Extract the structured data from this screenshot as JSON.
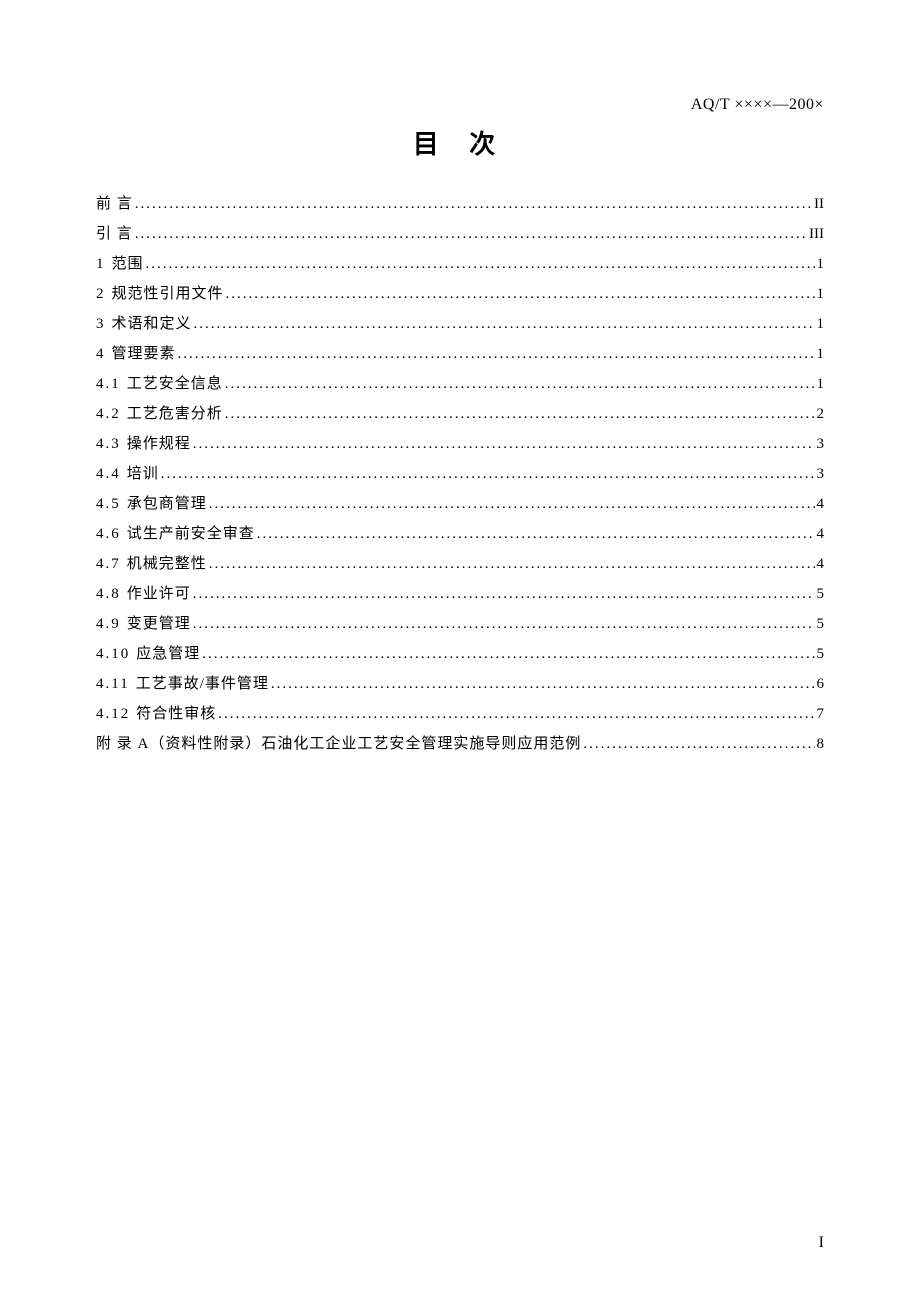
{
  "header": {
    "doc_code": "AQ/T ××××—200×"
  },
  "title": "目 次",
  "toc": [
    {
      "num": "",
      "label": "前  言",
      "spaced": false,
      "page": "II"
    },
    {
      "num": "",
      "label": "引  言",
      "spaced": false,
      "page": "III"
    },
    {
      "num": "1",
      "label": "范围",
      "spaced": false,
      "page": "1"
    },
    {
      "num": "2",
      "label": "规范性引用文件",
      "spaced": false,
      "page": "1"
    },
    {
      "num": "3",
      "label": "术语和定义",
      "spaced": false,
      "page": "1"
    },
    {
      "num": "4",
      "label": "管理要素",
      "spaced": false,
      "page": "1"
    },
    {
      "num": "4.1",
      "label": "工艺安全信息",
      "spaced": false,
      "page": "1"
    },
    {
      "num": "4.2",
      "label": "工艺危害分析",
      "spaced": false,
      "page": "2"
    },
    {
      "num": "4.3",
      "label": "操作规程",
      "spaced": false,
      "page": "3"
    },
    {
      "num": "4.4",
      "label": "培训",
      "spaced": false,
      "page": "3"
    },
    {
      "num": "4.5",
      "label": "承包商管理",
      "spaced": false,
      "page": "4"
    },
    {
      "num": "4.6",
      "label": "试生产前安全审查",
      "spaced": false,
      "page": "4"
    },
    {
      "num": "4.7",
      "label": "机械完整性",
      "spaced": false,
      "page": "4"
    },
    {
      "num": "4.8",
      "label": "作业许可",
      "spaced": false,
      "page": "5"
    },
    {
      "num": "4.9",
      "label": "变更管理",
      "spaced": false,
      "page": "5"
    },
    {
      "num": "4.10",
      "label": "应急管理",
      "spaced": false,
      "page": "5"
    },
    {
      "num": "4.11",
      "label": "工艺事故/事件管理",
      "spaced": false,
      "page": "6"
    },
    {
      "num": "4.12",
      "label": "符合性审核",
      "spaced": false,
      "page": "7"
    },
    {
      "num": "",
      "label": "附  录  A（资料性附录）石油化工企业工艺安全管理实施导则应用范例",
      "spaced": false,
      "page": "8"
    }
  ],
  "page_number": "I"
}
